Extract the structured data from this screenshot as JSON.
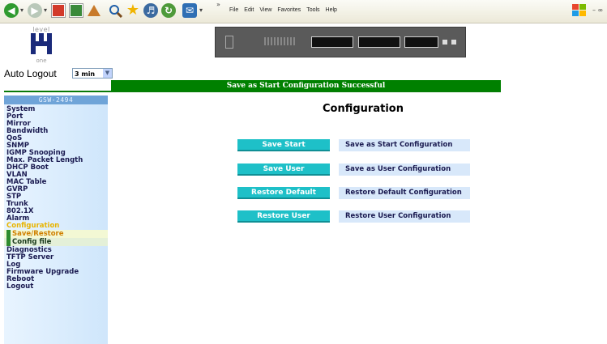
{
  "browser": {
    "menu": [
      "File",
      "Edit",
      "View",
      "Favorites",
      "Tools",
      "Help"
    ]
  },
  "header": {
    "logo_top": "level",
    "logo_bottom": "one",
    "auto_logout_label": "Auto Logout",
    "auto_logout_value": "3 min"
  },
  "banner": "Save as Start Configuration Successful",
  "sidebar": {
    "title": "GSW-2494",
    "items": [
      "System",
      "Port",
      "Mirror",
      "Bandwidth",
      "QoS",
      "SNMP",
      "IGMP Snooping",
      "Max. Packet Length",
      "DHCP Boot",
      "VLAN",
      "MAC Table",
      "GVRP",
      "STP",
      "Trunk",
      "802.1X",
      "Alarm"
    ],
    "active_item": "Configuration",
    "sub_items": [
      "Save/Restore",
      "Config file"
    ],
    "items_after": [
      "Diagnostics",
      "TFTP Server",
      "Log",
      "Firmware Upgrade",
      "Reboot",
      "Logout"
    ]
  },
  "main": {
    "title": "Configuration",
    "actions": [
      {
        "button": "Save Start",
        "description": "Save as Start Configuration"
      },
      {
        "button": "Save User",
        "description": "Save as User Configuration"
      },
      {
        "button": "Restore Default",
        "description": "Restore Default Configuration"
      },
      {
        "button": "Restore User",
        "description": "Restore User Configuration"
      }
    ]
  },
  "colors": {
    "banner": "#008000",
    "button": "#1ec0c8",
    "description_bg": "#d8e8fa",
    "sidebar_header": "#6fa4d8",
    "active_item": "#e8b400"
  }
}
